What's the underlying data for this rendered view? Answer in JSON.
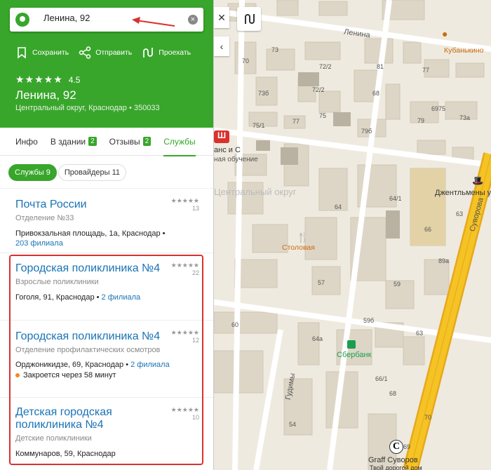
{
  "search": {
    "value": "Ленина, 92"
  },
  "actions": {
    "save": "Сохранить",
    "share": "Отправить",
    "route": "Проехать"
  },
  "place": {
    "stars": "★★★★★",
    "rating": "4.5",
    "title": "Ленина, 92",
    "address": "Центральный округ, Краснодар • 350033"
  },
  "tabs": [
    {
      "label": "Инфо"
    },
    {
      "label": "В здании",
      "badge": "2"
    },
    {
      "label": "Отзывы",
      "badge": "2"
    },
    {
      "label": "Службы"
    }
  ],
  "filters": {
    "services": "Службы 9",
    "providers": "Провайдеры 11"
  },
  "items": [
    {
      "name": "Почта России",
      "category": "Отделение №33",
      "address": "Привокзальная площадь, 1а, Краснодар",
      "branches": "203 филиала",
      "stars": "★★★★★",
      "reviews": "13"
    },
    {
      "name": "Городская поликлиника №4",
      "category": "Взрослые поликлиники",
      "address": "Гоголя, 91, Краснодар",
      "branches": "2 филиала",
      "stars": "★★★★★",
      "reviews": "22"
    },
    {
      "name": "Городская поликлиника №4",
      "category": "Отделение профилактических осмотров",
      "address": "Орджоникидзе, 69, Краснодар",
      "branches": "2 филиала",
      "closing": "Закроется через 58 минут",
      "stars": "★★★★★",
      "reviews": "12"
    },
    {
      "name": "Детская городская поликлиника №4",
      "category": "Детские поликлиники",
      "address": "Коммунаров, 59, Краснодар",
      "stars": "★★★★★",
      "reviews": "10"
    }
  ],
  "map": {
    "streets": {
      "lenina": "Ленина",
      "suvorova": "Суворова",
      "gudimy": "Гудимы"
    },
    "district": "Центральный округ",
    "pois": {
      "kuban": "Кубанькино",
      "school": "анс и С",
      "school2": "ная обучение",
      "stolovaya": "Столовая",
      "sber": "Сбербанк",
      "gentleman": "Джентльмены у",
      "graff": "Graff Суворов",
      "graff2": "Твой дорогой дом"
    },
    "numbers": [
      "70",
      "73",
      "72/2",
      "81",
      "77",
      "68",
      "73б",
      "72/2",
      "75",
      "69",
      "73а",
      "75/1",
      "77",
      "79б",
      "79",
      "75",
      "64",
      "63",
      "64/1",
      "66",
      "89а",
      "57",
      "59б",
      "59",
      "63",
      "60",
      "64а",
      "66/1",
      "68",
      "54",
      "69",
      "70"
    ]
  },
  "colors": {
    "accent": "#38a62b",
    "link": "#1a73b5",
    "highlight": "#d9322e",
    "road": "#f5c324"
  }
}
